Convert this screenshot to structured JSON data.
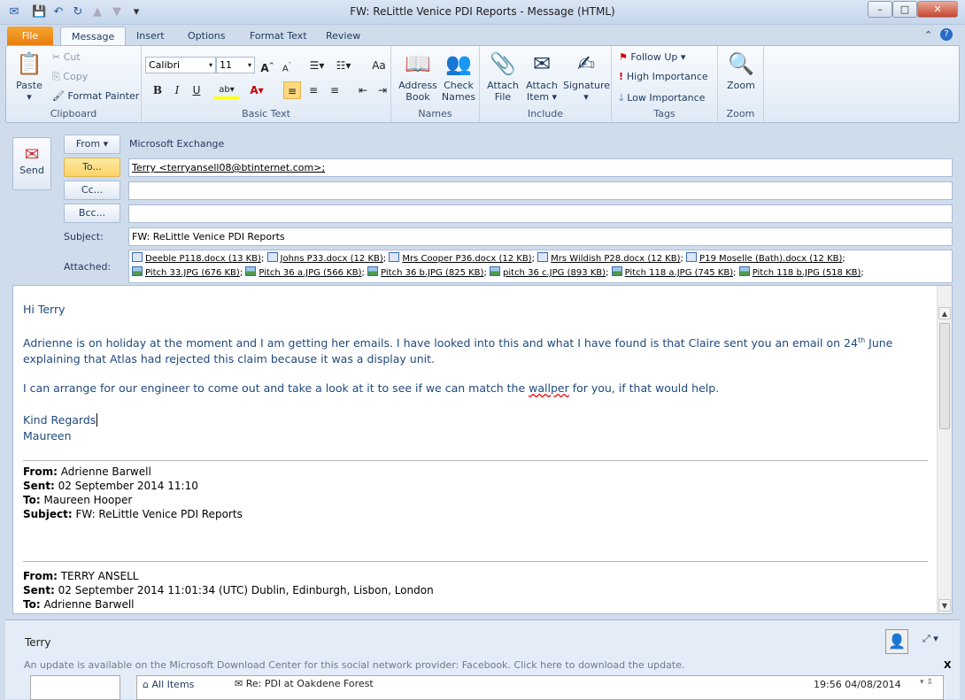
{
  "window": {
    "title": "FW: ReLittle Venice PDI Reports - Message (HTML)",
    "minimize": "–",
    "maximize": "□",
    "close": "✕"
  },
  "tabs": [
    "File",
    "Message",
    "Insert",
    "Options",
    "Format Text",
    "Review"
  ],
  "ribbon": {
    "clipboard": {
      "label": "Clipboard",
      "paste": "Paste",
      "cut": "Cut",
      "copy": "Copy",
      "format_painter": "Format Painter"
    },
    "basic_text": {
      "label": "Basic Text",
      "font": "Calibri",
      "size": "11"
    },
    "names": {
      "label": "Names",
      "address_book": [
        "Address",
        "Book"
      ],
      "check_names": [
        "Check",
        "Names"
      ]
    },
    "include": {
      "label": "Include",
      "attach_file": [
        "Attach",
        "File"
      ],
      "attach_item": [
        "Attach",
        "Item"
      ],
      "signature": "Signature"
    },
    "tags": {
      "label": "Tags",
      "follow_up": "Follow Up",
      "high": "High Importance",
      "low": "Low Importance"
    },
    "zoom": {
      "label": "Zoom",
      "zoom": "Zoom"
    }
  },
  "form": {
    "send": "Send",
    "from_btn": "From",
    "from_value": "Microsoft Exchange",
    "to_btn": "To...",
    "to_value": "Terry <terryansell08@btinternet.com>;",
    "cc_btn": "Cc...",
    "cc_value": "",
    "bcc_btn": "Bcc...",
    "bcc_value": "",
    "subject_label": "Subject:",
    "subject_value": "FW: ReLittle Venice PDI Reports",
    "attached_label": "Attached:",
    "attachments_docs": [
      "Deeble P118.docx (13 KB)",
      "Johns P33.docx (12 KB)",
      "Mrs Cooper P36.docx (12 KB)",
      "Mrs Wildish P28.docx (12 KB)",
      "P19 Moselle (Bath).docx (12 KB)"
    ],
    "attachments_images": [
      "Pitch 33.JPG (676 KB)",
      "Pitch 36 a.JPG (566 KB)",
      "Pitch 36 b.JPG (825 KB)",
      "pitch 36 c.JPG (893 KB)",
      "Pitch 118 a.JPG (745 KB)",
      "Pitch 118 b.JPG (518 KB)"
    ]
  },
  "body": {
    "greeting": "Hi Terry",
    "p1a": "Adrienne is on holiday at the moment and I am getting her emails.  I have looked into this and what I have found is that Claire sent you an email on 24",
    "p1_sup": "th",
    "p1b": " June explaining that Atlas had rejected this claim because it was a display unit.",
    "p2a": "I can arrange for our engineer to come out and take a look at it to see if we can match the ",
    "p2_misspelled": "wallper",
    "p2b": " for you, if that would help.",
    "closing": "Kind Regards",
    "signature": "Maureen",
    "fwd1": {
      "from_l": "From:",
      "from": " Adrienne Barwell",
      "sent_l": "Sent:",
      "sent": " 02 September 2014 11:10",
      "to_l": "To:",
      "to": " Maureen Hooper",
      "subject_l": "Subject:",
      "subject": " FW: ReLittle Venice PDI Reports"
    },
    "fwd2": {
      "from_l": "From:",
      "from": " TERRY ANSELL",
      "sent_l": "Sent:",
      "sent": " 02 September 2014 11:01:34 (UTC) Dublin, Edinburgh, Lisbon, London",
      "to_l": "To:",
      "to": " Adrienne Barwell"
    }
  },
  "people": {
    "name": "Terry",
    "notice": "An update is available on the Microsoft Download Center for this social network provider: Facebook. Click here to download the update.",
    "dismiss": "X",
    "all_items": "All Items",
    "item_subject": "Re: PDI at Oakdene Forest",
    "item_date": "19:56 04/08/2014"
  }
}
